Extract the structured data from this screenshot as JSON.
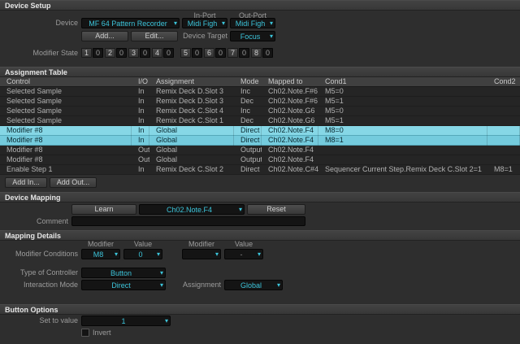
{
  "colors": {
    "accent": "#3cc5db",
    "selected_row": "#86d7e6"
  },
  "device_setup": {
    "title": "Device Setup",
    "device_label": "Device",
    "device_value": "MF 64 Pattern Recorder",
    "in_port_label": "In-Port",
    "in_port_value": "Midi Figh",
    "out_port_label": "Out-Port",
    "out_port_value": "Midi Figh",
    "add_button": "Add...",
    "edit_button": "Edit...",
    "device_target_label": "Device Target",
    "device_target_value": "Focus",
    "modifier_state_label": "Modifier State",
    "modifier_states": [
      {
        "num": "1",
        "val": "0"
      },
      {
        "num": "2",
        "val": "0"
      },
      {
        "num": "3",
        "val": "0"
      },
      {
        "num": "4",
        "val": "0"
      },
      {
        "num": "5",
        "val": "0"
      },
      {
        "num": "6",
        "val": "0"
      },
      {
        "num": "7",
        "val": "0"
      },
      {
        "num": "8",
        "val": "0"
      }
    ]
  },
  "assignment_table": {
    "title": "Assignment Table",
    "columns": [
      "Control",
      "I/O",
      "Assignment",
      "Mode",
      "Mapped to",
      "Cond1",
      "Cond2"
    ],
    "rows": [
      {
        "control": "Selected Sample",
        "io": "In",
        "assignment": "Remix Deck D.Slot 3",
        "mode": "Inc",
        "mapped_to": "Ch02.Note.F#6",
        "cond1": "M5=0",
        "cond2": "",
        "selected": false
      },
      {
        "control": "Selected Sample",
        "io": "In",
        "assignment": "Remix Deck D.Slot 3",
        "mode": "Dec",
        "mapped_to": "Ch02.Note.F#6",
        "cond1": "M5=1",
        "cond2": "",
        "selected": false
      },
      {
        "control": "Selected Sample",
        "io": "In",
        "assignment": "Remix Deck C.Slot 4",
        "mode": "Inc",
        "mapped_to": "Ch02.Note.G6",
        "cond1": "M5=0",
        "cond2": "",
        "selected": false
      },
      {
        "control": "Selected Sample",
        "io": "In",
        "assignment": "Remix Deck C.Slot 1",
        "mode": "Dec",
        "mapped_to": "Ch02.Note.G6",
        "cond1": "M5=1",
        "cond2": "",
        "selected": false
      },
      {
        "control": "Modifier #8",
        "io": "In",
        "assignment": "Global",
        "mode": "Direct",
        "mapped_to": "Ch02.Note.F4",
        "cond1": "M8=0",
        "cond2": "",
        "selected": true
      },
      {
        "control": "Modifier #8",
        "io": "In",
        "assignment": "Global",
        "mode": "Direct",
        "mapped_to": "Ch02.Note.F4",
        "cond1": "M8=1",
        "cond2": "",
        "selected": true
      },
      {
        "control": "Modifier #8",
        "io": "Out",
        "assignment": "Global",
        "mode": "Output",
        "mapped_to": "Ch02.Note.F4",
        "cond1": "",
        "cond2": "",
        "selected": false
      },
      {
        "control": "Modifier #8",
        "io": "Out",
        "assignment": "Global",
        "mode": "Output",
        "mapped_to": "Ch02.Note.F4",
        "cond1": "",
        "cond2": "",
        "selected": false
      },
      {
        "control": "Enable Step 1",
        "io": "In",
        "assignment": "Remix Deck C.Slot 2",
        "mode": "Direct",
        "mapped_to": "Ch02.Note.C#4",
        "cond1": "Sequencer Current Step.Remix Deck C.Slot 2=1",
        "cond2": "M8=1",
        "selected": false
      }
    ],
    "add_in_button": "Add In...",
    "add_out_button": "Add Out..."
  },
  "device_mapping": {
    "title": "Device Mapping",
    "learn_button": "Learn",
    "mapped_value": "Ch02.Note.F4",
    "reset_button": "Reset",
    "comment_label": "Comment",
    "comment_value": ""
  },
  "mapping_details": {
    "title": "Mapping Details",
    "modifier_col_label_1": "Modifier",
    "value_col_label_1": "Value",
    "modifier_col_label_2": "Modifier",
    "value_col_label_2": "Value",
    "modifier_conditions_label": "Modifier Conditions",
    "cond1_modifier": "M8",
    "cond1_value": "0",
    "cond2_modifier": "",
    "cond2_value": "-",
    "type_of_controller_label": "Type of Controller",
    "type_of_controller_value": "Button",
    "interaction_mode_label": "Interaction Mode",
    "interaction_mode_value": "Direct",
    "assignment_label": "Assignment",
    "assignment_value": "Global"
  },
  "button_options": {
    "title": "Button Options",
    "set_to_value_label": "Set to value",
    "set_to_value": "1",
    "invert_label": "Invert"
  }
}
